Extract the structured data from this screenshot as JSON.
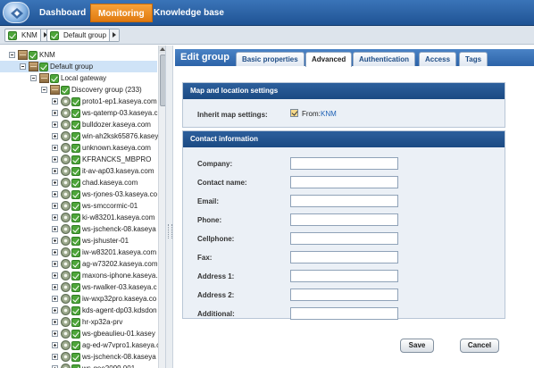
{
  "topnav": {
    "tabs": [
      {
        "label": "Dashboard"
      },
      {
        "label": "Monitoring"
      },
      {
        "label": "Knowledge base"
      }
    ],
    "active": "Monitoring"
  },
  "breadcrumb": {
    "items": [
      {
        "label": "KNM"
      },
      {
        "label": "Default group"
      }
    ]
  },
  "tree": {
    "root": "KNM",
    "default_group": "Default group",
    "gateway": "Local gateway",
    "discovery_group": "Discovery group (233)",
    "devices": [
      "proto1-ep1.kaseya.com",
      "ws-qatemp-03.kaseya.c",
      "bulldozer.kaseya.com",
      "win-ah2ksk65876.kasey",
      "unknown.kaseya.com",
      "KFRANCKS_MBPRO",
      "it-av-ap03.kaseya.com",
      "chad.kaseya.com",
      "ws-rjones-03.kaseya.co",
      "ws-smccormic-01",
      "ki-w83201.kaseya.com",
      "ws-jschenck-08.kaseya",
      "ws-jshuster-01",
      "iw-w83201.kaseya.com",
      "ag-w73202.kaseya.com",
      "maxons-iphone.kaseya.",
      "ws-rwalker-03.kaseya.c",
      "iw-wxp32pro.kaseya.co",
      "kds-agent-dp03.kdsdon",
      "hr-xp32a-prv",
      "ws-gbeaulieu-01.kasey",
      "ag-ed-w7vpro1.kaseya.c",
      "ws-jschenck-08.kaseya",
      "ws-gee2099.001"
    ]
  },
  "editor": {
    "title": "Edit group",
    "tabs": [
      {
        "label": "Basic properties"
      },
      {
        "label": "Advanced"
      },
      {
        "label": "Authentication"
      },
      {
        "label": "Access"
      },
      {
        "label": "Tags"
      }
    ],
    "active_tab": "Advanced",
    "map_section": {
      "title": "Map and location settings",
      "inherit_label": "Inherit map settings:",
      "inherit_checked": true,
      "from_label": "From:",
      "from_link": "KNM"
    },
    "contact_section": {
      "title": "Contact information",
      "fields": [
        {
          "label": "Company:",
          "value": ""
        },
        {
          "label": "Contact name:",
          "value": ""
        },
        {
          "label": "Email:",
          "value": ""
        },
        {
          "label": "Phone:",
          "value": ""
        },
        {
          "label": "Cellphone:",
          "value": ""
        },
        {
          "label": "Fax:",
          "value": ""
        },
        {
          "label": "Address 1:",
          "value": ""
        },
        {
          "label": "Address 2:",
          "value": ""
        },
        {
          "label": "Additional:",
          "value": ""
        }
      ]
    },
    "save_label": "Save",
    "cancel_label": "Cancel"
  },
  "colors": {
    "topbar": "#2c63a8",
    "active_tab": "#f08c1e",
    "section_header": "#1f4f8a",
    "link": "#1c5fb4"
  }
}
